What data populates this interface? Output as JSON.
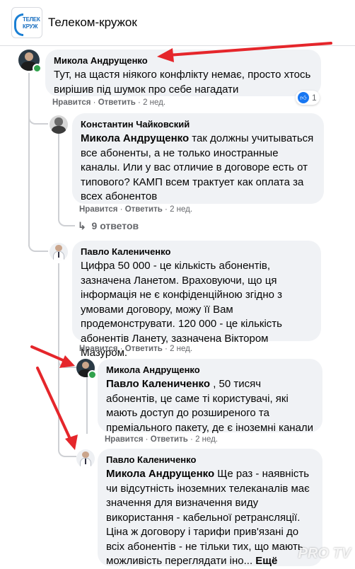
{
  "group": {
    "logo_text_1": "ТЕЛЕК",
    "logo_text_2": "КРУЖ",
    "title": "Телеком-кружок"
  },
  "comments": [
    {
      "author": "Микола Андрущенко",
      "text": "Тут, на щастя ніякого конфлікту немає, просто хтось вирішив під шумок про себе нагадати",
      "actions": {
        "like": "Нравится",
        "reply": "Ответить",
        "time": "2 нед."
      },
      "reaction_count": "1"
    },
    {
      "author": "Константин Чайковский",
      "mention": "Микола Андрущенко",
      "text": " так должны учитываться все абоненты, а не только иностранные каналы. Или у вас отличие в договоре есть от типового? КАМП всем трактует как оплата за всех абонентов",
      "actions": {
        "like": "Нравится",
        "reply": "Ответить",
        "time": "2 нед."
      },
      "replies_label": "9 ответов"
    },
    {
      "author": "Павло Калениченко",
      "text": "Цифра 50 000 - це кількість абонентів, зазначена Ланетом. Враховуючи, що ця інформація не є конфіденційною згідно з умовами договору, можу її Вам продемонструвати. 120 000 - це кількість абонентів Ланету, зазначена Віктором Мазуром.",
      "actions": {
        "like": "Нравится",
        "reply": "Ответить",
        "time": "2 нед."
      }
    },
    {
      "author": "Микола Андрущенко",
      "mention": "Павло Калениченко",
      "text": " , 50 тисяч абонентів, це саме ті користувачі, які мають доступ до розширеного та преміального пакету, де є іноземні канали",
      "actions": {
        "like": "Нравится",
        "reply": "Ответить",
        "time": "2 нед."
      }
    },
    {
      "author": "Павло Калениченко",
      "mention": "Микола Андрущенко",
      "text": " Ще раз - наявність чи відсутність іноземних телеканалів має значення для визначення виду використання - кабельної ретрансляції. Ціна ж договору і тарифи прив'язані до всіх абонентів - не тільки тих, що мають можливість переглядати іно...",
      "more": " Ещё"
    }
  ],
  "icons": {
    "like": "thumbs-up-icon",
    "reply_arrow": "reply-arrow-icon"
  },
  "colors": {
    "annotation_arrow": "#e5262b",
    "online": "#31a24c",
    "like": "#1877f2"
  },
  "watermark": "PRO TV"
}
